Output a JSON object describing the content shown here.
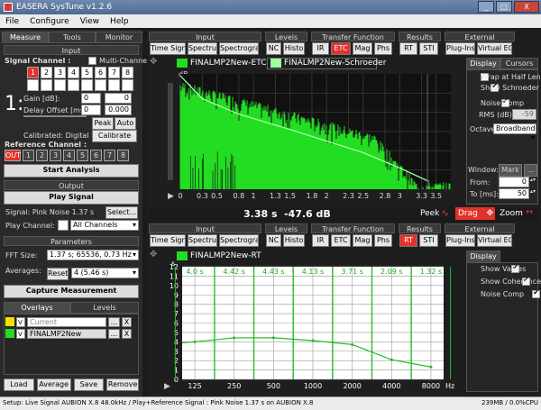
{
  "window": {
    "title": "EASERA SysTune v1.2.6",
    "controls": [
      "_",
      "□",
      "X"
    ]
  },
  "menu": [
    "File",
    "Configure",
    "View",
    "Help"
  ],
  "left": {
    "tabs": [
      "Measure",
      "Tools",
      "Monitor"
    ],
    "input": {
      "title": "Input",
      "signal_label": "Signal Channel :",
      "multi_label": "Multi-Channel",
      "channels": [
        "1",
        "2",
        "3",
        "4",
        "5",
        "6",
        "7",
        "8"
      ],
      "channel_number": "1:",
      "gain_label": "Gain [dB]:",
      "gain1": "0",
      "gain2": "0",
      "delay_label": "Delay Offset [ms]:",
      "delay1": "0",
      "delay2": "0.000",
      "peak": "Peak",
      "auto": "Auto",
      "calibrated": "Calibrated: Digital FS",
      "calibrate": "Calibrate",
      "ref_label": "Reference Channel :",
      "ref_out": "OUT",
      "start": "Start Analysis"
    },
    "output": {
      "title": "Output",
      "play": "Play Signal",
      "signal_text": "Signal: Pink Noise  1.37 s",
      "select": "Select...",
      "play_channel_label": "Play Channel:",
      "play_channel_value": "All Channels"
    },
    "parameters": {
      "title": "Parameters",
      "fft_label": "FFT Size:",
      "fft_value": "1.37 s; 65536, 0.73 Hz",
      "avg_label": "Averages:",
      "reset": "Reset",
      "avg_value": "4 (5.46 s)",
      "capture": "Capture Measurement"
    },
    "overlays": {
      "tabs": [
        "Overlays",
        "Levels"
      ],
      "items": [
        {
          "color": "#f5e000",
          "v": "V",
          "name": "Current Measurement"
        },
        {
          "color": "#22dd22",
          "v": "V",
          "name": "FINALMP2New"
        }
      ],
      "dots": "...",
      "close": "X",
      "buttons": [
        "Load",
        "Average",
        "Save",
        "Remove"
      ]
    }
  },
  "toolbar": {
    "groups": [
      {
        "title": "Input",
        "buttons": [
          "Time Signal",
          "Spectrum",
          "Spectrogram"
        ]
      },
      {
        "title": "Levels",
        "buttons": [
          "NC",
          "Histo"
        ]
      },
      {
        "title": "Transfer Function",
        "buttons": [
          "IR",
          "ETC",
          "Mag",
          "Phs"
        ]
      },
      {
        "title": "Results",
        "buttons": [
          "RT",
          "STI"
        ]
      },
      {
        "title": "External",
        "buttons": [
          "Plug-Ins",
          "Virtual EQ"
        ]
      }
    ]
  },
  "top_chart": {
    "legend": [
      "FINALMP2New-ETC",
      "FINALMP2New-Schroeder"
    ],
    "ylabel": "dB",
    "xticks": [
      "0",
      "0.3",
      "0.5",
      "0.8",
      "1",
      "1.3",
      "1.5",
      "1.8",
      "2",
      "2.3",
      "2.5",
      "2.8",
      "3",
      "3.3",
      "3.5"
    ]
  },
  "top_side": {
    "tabs": [
      "Display",
      "Cursors"
    ],
    "wrap": "Wrap at Half Length",
    "schroeder": "Show Schroeder",
    "noise": "Noise Comp",
    "rms_label": "RMS (dB):",
    "rms_value": "-59",
    "octave_label": "Octave:",
    "octave_value": "Broadband",
    "window_label": "Window:",
    "mark": "Mark",
    "from_label": "From:",
    "from_value": "0",
    "to_label": "To [ms]:",
    "to_value": "50"
  },
  "readout": {
    "time": "3.38 s",
    "level": "-47.6 dB",
    "peek": "Peek",
    "drag": "Drag",
    "zoom": "Zoom"
  },
  "bottom_chart": {
    "legend": [
      "FINALMP2New-RT"
    ],
    "yunit": "s",
    "xunit": "Hz",
    "yticks": [
      "12",
      "11",
      "10",
      "9",
      "8",
      "7",
      "6",
      "5",
      "4",
      "3",
      "2",
      "1",
      "0"
    ],
    "xticks": [
      "125",
      "250",
      "500",
      "1000",
      "2000",
      "4000",
      "8000"
    ],
    "band_labels": [
      "4.0 s",
      "4.42 s",
      "4.43 s",
      "4.13 s",
      "3.71 s",
      "2.09 s",
      "1.32 s"
    ]
  },
  "bottom_side": {
    "tab": "Display",
    "values": "Show Values",
    "coherence": "Show Coherence",
    "noise": "Noise Comp"
  },
  "chart_data": [
    {
      "type": "line",
      "xlabel": "",
      "ylabel": "dB",
      "xlim": [
        0,
        3.7
      ],
      "series": [
        {
          "name": "FINALMP2New-Schroeder",
          "x": [
            0,
            0.3,
            0.8,
            1.5,
            2,
            2.5,
            3,
            3.4
          ],
          "values": [
            0,
            -12,
            -20,
            -28,
            -34,
            -40,
            -48,
            -55
          ]
        }
      ]
    },
    {
      "type": "line",
      "xlabel": "Hz",
      "ylabel": "s",
      "ylim": [
        0,
        12
      ],
      "categories": [
        "125",
        "250",
        "500",
        "1000",
        "2000",
        "4000",
        "8000"
      ],
      "series": [
        {
          "name": "FINALMP2New-RT",
          "values": [
            4.0,
            4.42,
            4.43,
            4.13,
            3.71,
            2.09,
            1.32
          ]
        }
      ]
    }
  ],
  "status": {
    "left": "Setup: Live Signal AUBION X.8 48.0kHz / Play+Reference Signal : Pink Noise  1.37 s on AUBION X.8",
    "right": "239MB / 0.0%CPU"
  }
}
